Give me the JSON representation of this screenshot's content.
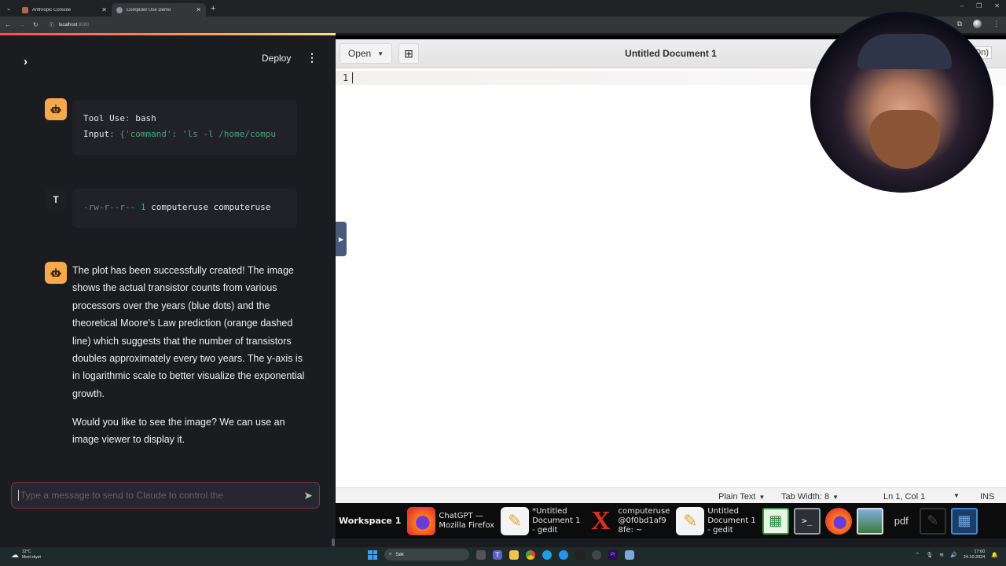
{
  "browser": {
    "tabs": [
      {
        "title": "Anthropic Console",
        "active": false,
        "favicon": "anthropic-icon"
      },
      {
        "title": "Computer Use Demo",
        "active": true,
        "favicon": "globe-icon"
      }
    ],
    "url_host": "localhost",
    "url_port": ":8080"
  },
  "streamlit": {
    "deploy_label": "Deploy",
    "messages": [
      {
        "role": "assistant",
        "type": "code",
        "line1_key": "Tool Use",
        "line1_val": "bash",
        "line2_key": "Input",
        "line2_val": "{'command': 'ls -l /home/compu"
      },
      {
        "role": "tool",
        "avatar_letter": "T",
        "type": "code",
        "perms": "-rw-r--r--",
        "links": "1",
        "owner": "computeruse computeruse"
      },
      {
        "role": "assistant",
        "type": "text",
        "paragraph1": "The plot has been successfully created! The image shows the actual transistor counts from various processors over the years (blue dots) and the theoretical Moore's Law prediction (orange dashed line) which suggests that the number of transistors doubles approximately every two years. The y-axis is in logarithmic scale to better visualize the exponential growth.",
        "paragraph2": "Would you like to see the image? We can use an image viewer to display it."
      }
    ],
    "chat_input": {
      "placeholder": "Type a message to send to Claude to control the",
      "value": ""
    }
  },
  "gedit": {
    "open_label": "Open",
    "title": "Untitled Document 1",
    "on_label": "(On)",
    "line_number": "1",
    "status": {
      "language": "Plain Text",
      "tab_width": "Tab Width: 8",
      "position": "Ln 1, Col 1",
      "mode": "INS"
    }
  },
  "xfce_panel": {
    "workspace": "Workspace 1",
    "tasks": [
      {
        "label": "ChatGPT —\nMozilla Firefox",
        "icon": "firefox-icon"
      },
      {
        "label": "*Untitled\nDocument 1\n- gedit",
        "icon": "gedit-icon"
      },
      {
        "label": "computeruse\n@0f0bd1af9\n8fe: ~",
        "icon": "xterm-icon"
      },
      {
        "label": "Untitled\nDocument 1\n- gedit",
        "icon": "gedit-icon"
      }
    ],
    "launchers": [
      "spreadsheet-icon",
      "terminal-icon",
      "firefox-icon",
      "image-viewer-icon",
      "pdf-icon",
      "text-editor-icon",
      "calculator-icon"
    ],
    "pdf_label": "pdf"
  },
  "windows_taskbar": {
    "weather_temp": "12°C",
    "weather_desc": "Mest skyet",
    "search_placeholder": "Søk",
    "time": "17:00",
    "date": "24.10.2024"
  },
  "colors": {
    "accent": "#ff4b4b",
    "bot_avatar": "#f7a84b",
    "code_string": "#3fa779"
  }
}
